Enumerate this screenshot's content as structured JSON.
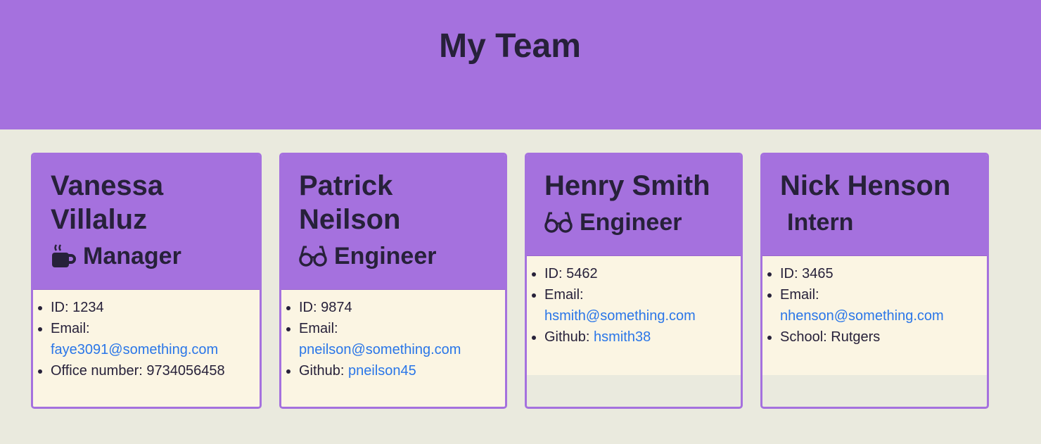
{
  "header": {
    "title": "My Team"
  },
  "cards": [
    {
      "name": "Vanessa Villaluz",
      "role": "Manager",
      "role_icon": "coffee-mug-icon",
      "items": [
        {
          "label": "ID: ",
          "value": "1234"
        },
        {
          "label": "Email: ",
          "value": "faye3091@something.com"
        },
        {
          "label": "Office number: ",
          "value": "9734056458"
        }
      ]
    },
    {
      "name": "Patrick Neilson",
      "role": "Engineer",
      "role_icon": "glasses-icon",
      "items": [
        {
          "label": "ID: ",
          "value": "9874"
        },
        {
          "label": "Email: ",
          "value": "pneilson@something.com"
        },
        {
          "label": "Github: ",
          "value": "pneilson45"
        }
      ]
    },
    {
      "name": "Henry Smith",
      "role": "Engineer",
      "role_icon": "glasses-icon",
      "items": [
        {
          "label": "ID: ",
          "value": "5462"
        },
        {
          "label": "Email: ",
          "value": "hsmith@something.com"
        },
        {
          "label": "Github: ",
          "value": "hsmith38"
        }
      ]
    },
    {
      "name": "Nick Henson",
      "role": "Intern",
      "role_icon": "",
      "items": [
        {
          "label": "ID: ",
          "value": "3465"
        },
        {
          "label": "Email: ",
          "value": "nhenson@something.com"
        },
        {
          "label": "School: ",
          "value": "Rutgers"
        }
      ]
    }
  ],
  "colors": {
    "header_bg": "#a571de",
    "page_bg": "#eaeade",
    "card_body_bg": "#fbf5e3",
    "text": "#27213a",
    "link": "#2a76e8"
  }
}
